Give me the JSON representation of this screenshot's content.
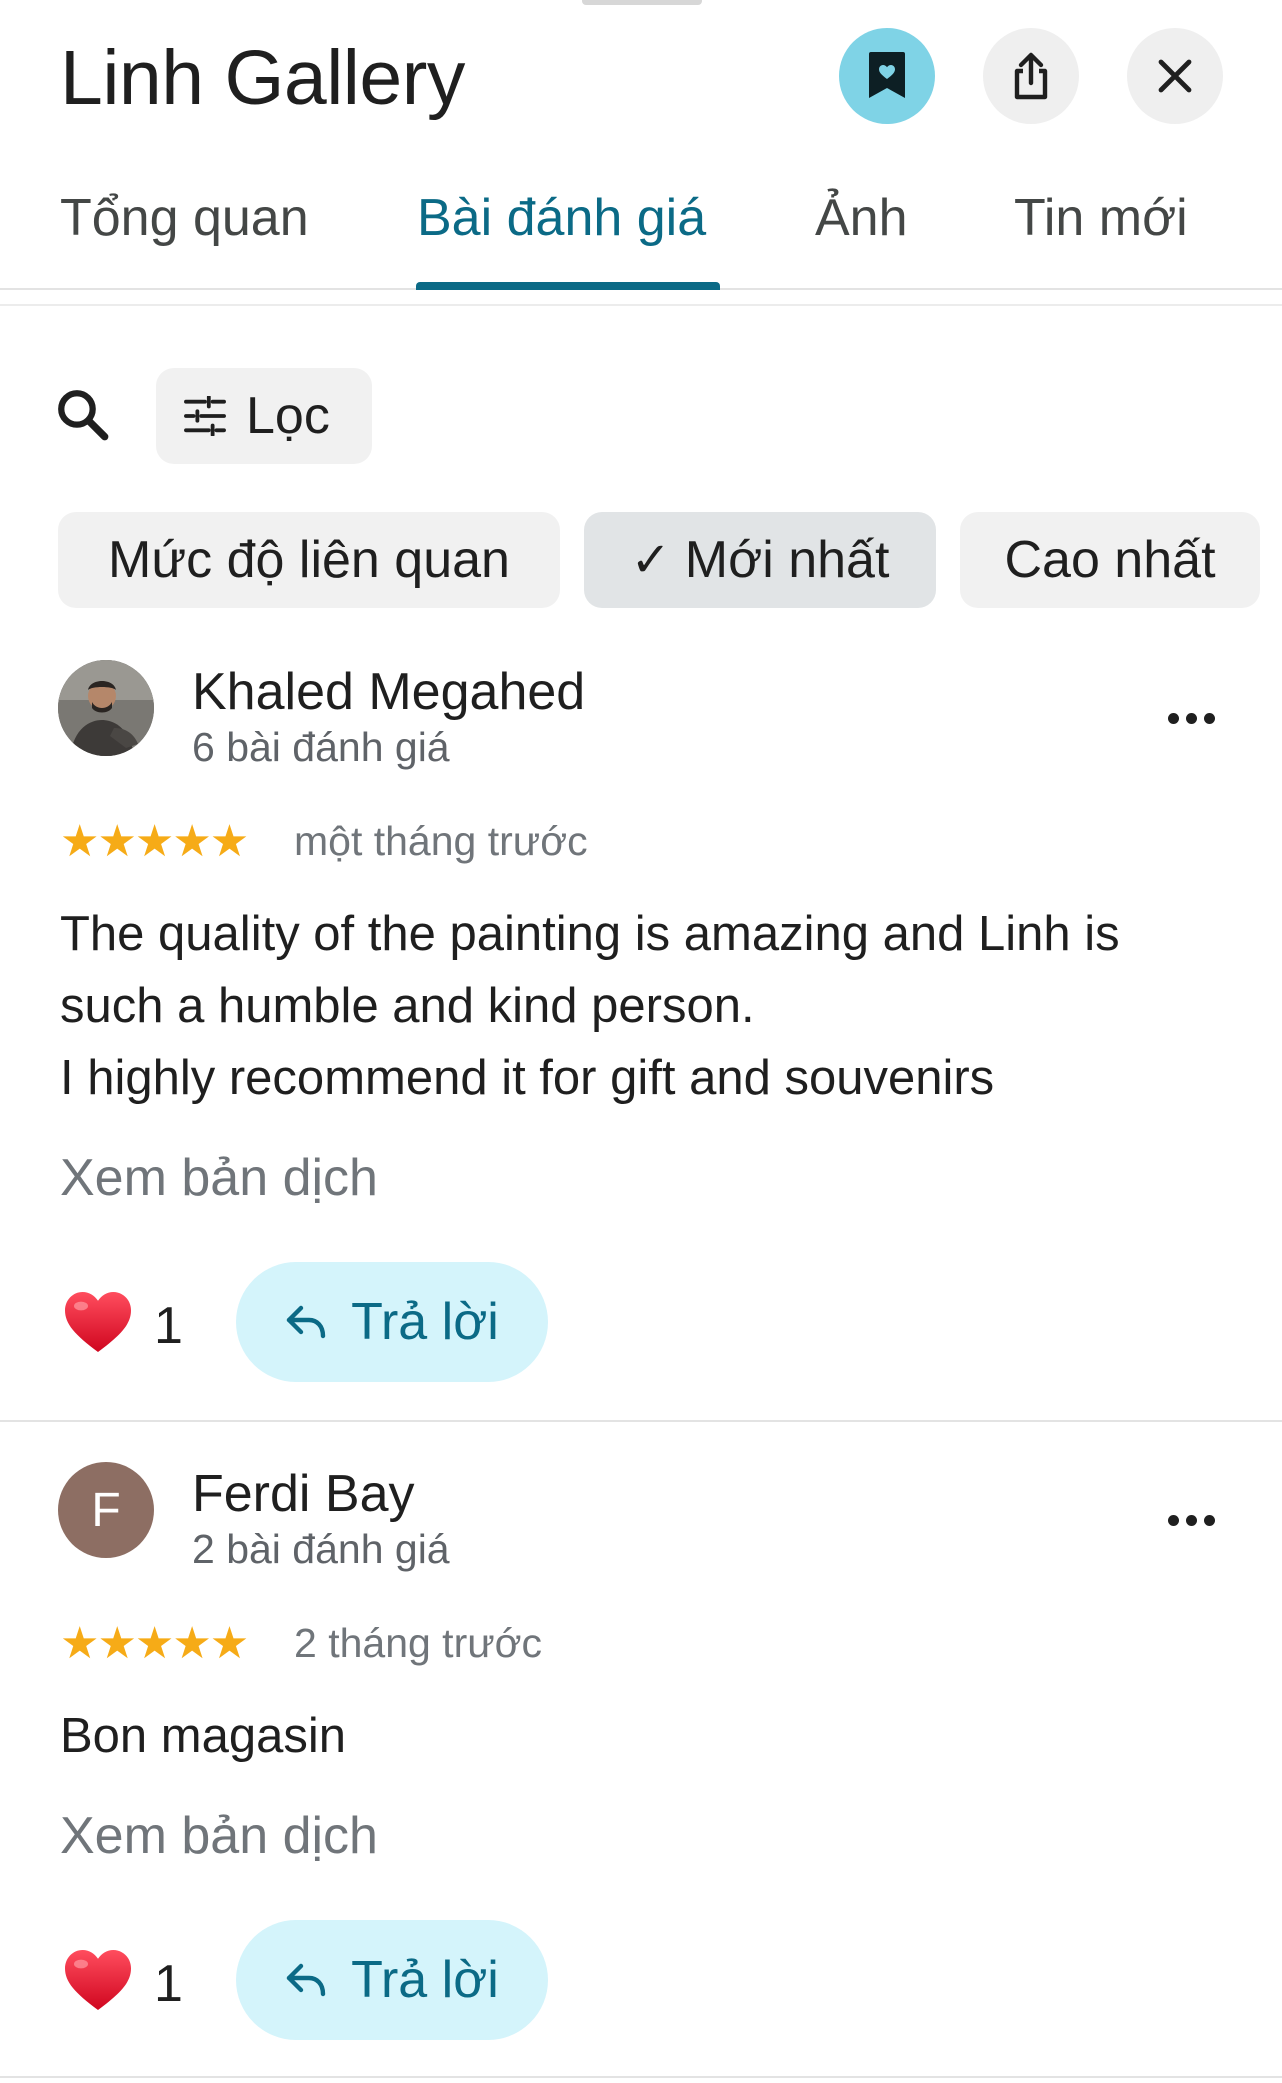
{
  "header": {
    "title": "Linh Gallery",
    "save_icon": "bookmark-heart-icon",
    "share_icon": "share-icon",
    "close_icon": "close-icon"
  },
  "tabs": [
    {
      "label": "Tổng quan",
      "active": false
    },
    {
      "label": "Bài đánh giá",
      "active": true
    },
    {
      "label": "Ảnh",
      "active": false
    },
    {
      "label": "Tin mới",
      "active": false
    }
  ],
  "toolbar": {
    "search_icon": "search-icon",
    "filter_label": "Lọc",
    "filter_icon": "tune-icon"
  },
  "sort_chips": [
    {
      "label": "Mức độ liên quan",
      "selected": false
    },
    {
      "label": "Mới nhất",
      "selected": true
    },
    {
      "label": "Cao nhất",
      "selected": false
    }
  ],
  "reviews": [
    {
      "author": "Khaled Megahed",
      "review_count": "6 bài đánh giá",
      "rating": 5,
      "stars": "★★★★★",
      "time": "một tháng trước",
      "text_lines": [
        "The quality of the painting is amazing and Linh is",
        "such a humble and kind person.",
        "I highly recommend it for gift and souvenirs"
      ],
      "translate_label": "Xem bản dịch",
      "likes": "1",
      "reply_label": "Trả lời"
    },
    {
      "author": "Ferdi Bay",
      "avatar_letter": "F",
      "review_count": "2 bài đánh giá",
      "rating": 5,
      "stars": "★★★★★",
      "time": "2 tháng trước",
      "text_lines": [
        "Bon magasin"
      ],
      "translate_label": "Xem bản dịch",
      "likes": "1",
      "reply_label": "Trả lời"
    }
  ],
  "colors": {
    "accent": "#0b6a86",
    "save_button": "#7fd3e6",
    "reply_button": "#d4f4fb",
    "star": "#f6ab17",
    "heart": "#e0102a"
  }
}
